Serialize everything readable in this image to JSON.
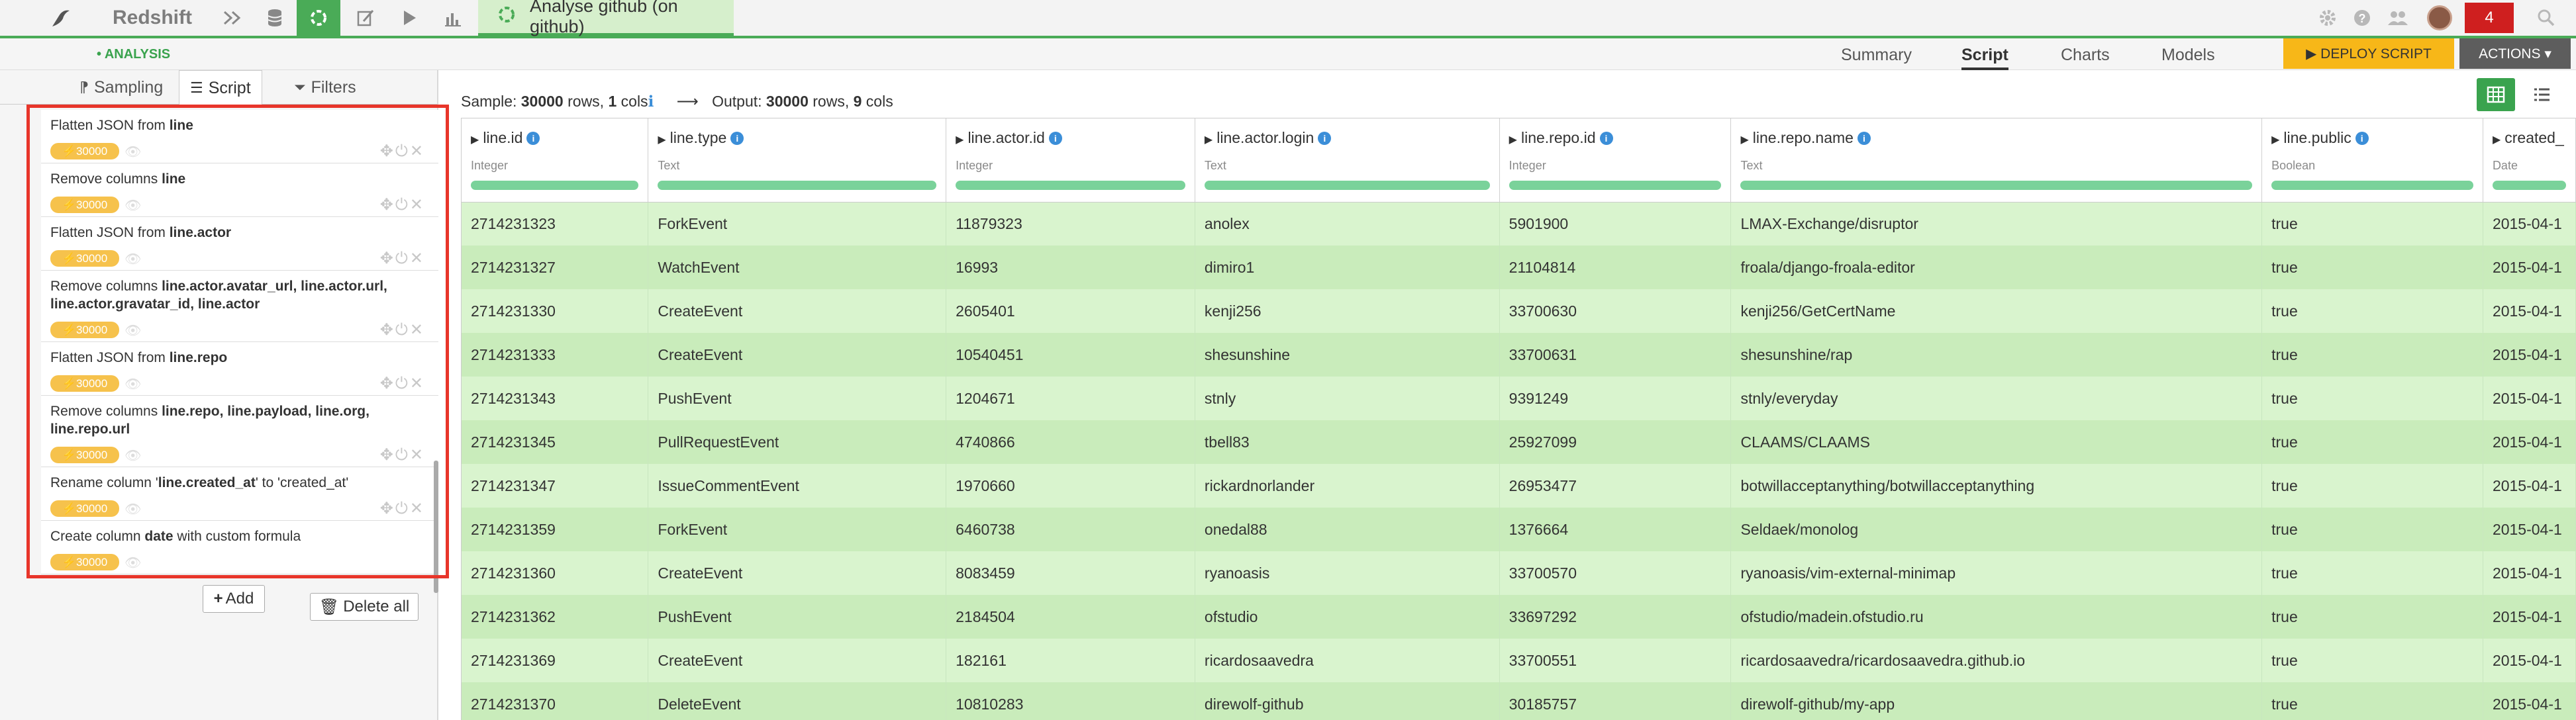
{
  "topbar": {
    "app_name": "Redshift",
    "project_tab": "Analyse github (on github)",
    "notification_count": "4",
    "icons": [
      "bird-logo-icon",
      "flow-icon",
      "database-icon",
      "recipe-icon",
      "notebook-icon",
      "play-icon",
      "chart-icon",
      "gear-icon",
      "help-icon",
      "people-icon",
      "avatar",
      "search-icon"
    ]
  },
  "subbar": {
    "section_label": "• ANALYSIS",
    "tabs": [
      "Summary",
      "Script",
      "Charts",
      "Models"
    ],
    "active_tab": "Script",
    "deploy_label": "▶ DEPLOY SCRIPT",
    "actions_label": "ACTIONS ▾"
  },
  "left_panel": {
    "tabs": [
      {
        "label": "Sampling",
        "icon": "sampling-icon"
      },
      {
        "label": "Script",
        "icon": "list-icon"
      },
      {
        "label": "Filters",
        "icon": "filter-icon"
      }
    ],
    "active_tab": "Script",
    "badge_label": "30000",
    "steps": [
      {
        "prefix": "Flatten JSON from ",
        "bold": "line",
        "suffix": ""
      },
      {
        "prefix": "Remove columns ",
        "bold": "line",
        "suffix": ""
      },
      {
        "prefix": "Flatten JSON from ",
        "bold": "line.actor",
        "suffix": ""
      },
      {
        "prefix": "Remove columns ",
        "bold": "line.actor.avatar_url, line.actor.url, line.actor.gravatar_id, line.actor",
        "suffix": ""
      },
      {
        "prefix": "Flatten JSON from ",
        "bold": "line.repo",
        "suffix": ""
      },
      {
        "prefix": "Remove columns ",
        "bold": "line.repo, line.payload, line.org, line.repo.url",
        "suffix": ""
      },
      {
        "prefix": "Rename column '",
        "bold": "line.created_at",
        "suffix": "' to 'created_at'"
      },
      {
        "prefix": "Create column ",
        "bold": "date",
        "suffix": " with custom formula"
      }
    ],
    "add_label": "Add",
    "delete_all_label": "Delete all"
  },
  "sample": {
    "label": "Sample:",
    "rows": "30000",
    "rows_word": "rows,",
    "cols": "1",
    "cols_word": "cols",
    "output_label": "Output:",
    "output_rows": "30000",
    "output_rows_word": "rows,",
    "output_cols": "9",
    "output_cols_word": "cols"
  },
  "table": {
    "columns": [
      {
        "name": "line.id",
        "type": "Integer"
      },
      {
        "name": "line.type",
        "type": "Text"
      },
      {
        "name": "line.actor.id",
        "type": "Integer"
      },
      {
        "name": "line.actor.login",
        "type": "Text"
      },
      {
        "name": "line.repo.id",
        "type": "Integer"
      },
      {
        "name": "line.repo.name",
        "type": "Text"
      },
      {
        "name": "line.public",
        "type": "Boolean"
      },
      {
        "name": "created_",
        "type": "Date"
      }
    ],
    "rows": [
      [
        "2714231323",
        "ForkEvent",
        "11879323",
        "anolex",
        "5901900",
        "LMAX-Exchange/disruptor",
        "true",
        "2015-04-1"
      ],
      [
        "2714231327",
        "WatchEvent",
        "16993",
        "dimiro1",
        "21104814",
        "froala/django-froala-editor",
        "true",
        "2015-04-1"
      ],
      [
        "2714231330",
        "CreateEvent",
        "2605401",
        "kenji256",
        "33700630",
        "kenji256/GetCertName",
        "true",
        "2015-04-1"
      ],
      [
        "2714231333",
        "CreateEvent",
        "10540451",
        "shesunshine",
        "33700631",
        "shesunshine/rap",
        "true",
        "2015-04-1"
      ],
      [
        "2714231343",
        "PushEvent",
        "1204671",
        "stnly",
        "9391249",
        "stnly/everyday",
        "true",
        "2015-04-1"
      ],
      [
        "2714231345",
        "PullRequestEvent",
        "4740866",
        "tbell83",
        "25927099",
        "CLAAMS/CLAAMS",
        "true",
        "2015-04-1"
      ],
      [
        "2714231347",
        "IssueCommentEvent",
        "1970660",
        "rickardnorlander",
        "26953477",
        "botwillacceptanything/botwillacceptanything",
        "true",
        "2015-04-1"
      ],
      [
        "2714231359",
        "ForkEvent",
        "6460738",
        "onedal88",
        "1376664",
        "Seldaek/monolog",
        "true",
        "2015-04-1"
      ],
      [
        "2714231360",
        "CreateEvent",
        "8083459",
        "ryanoasis",
        "33700570",
        "ryanoasis/vim-external-minimap",
        "true",
        "2015-04-1"
      ],
      [
        "2714231362",
        "PushEvent",
        "2184504",
        "ofstudio",
        "33697292",
        "ofstudio/madein.ofstudio.ru",
        "true",
        "2015-04-1"
      ],
      [
        "2714231369",
        "CreateEvent",
        "182161",
        "ricardosaavedra",
        "33700551",
        "ricardosaavedra/ricardosaavedra.github.io",
        "true",
        "2015-04-1"
      ],
      [
        "2714231370",
        "DeleteEvent",
        "10810283",
        "direwolf-github",
        "30185757",
        "direwolf-github/my-app",
        "true",
        "2015-04-1"
      ]
    ]
  },
  "colors": {
    "accent_green": "#4aab57",
    "deploy_yellow": "#f7b718",
    "highlight_red": "#e8352a",
    "row_light": "#d9f4ce",
    "row_dark": "#c9ecbb"
  }
}
